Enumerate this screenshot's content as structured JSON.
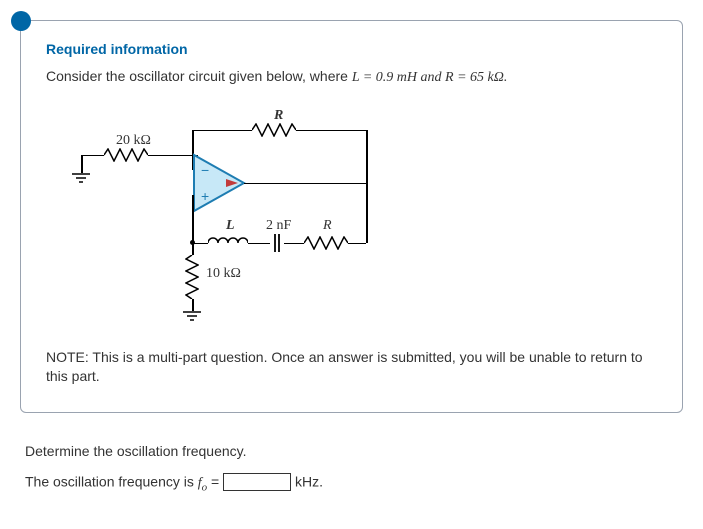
{
  "header": {
    "title": "Required information",
    "prompt_lead": "Consider the oscillator circuit given below, where ",
    "prompt_vars": "L = 0.9 mH and R = 65 kΩ."
  },
  "circuit": {
    "r_top_label": "R",
    "r_input_label": "20 kΩ",
    "L_label": "L",
    "cap_label": "2 nF",
    "R_right_label": "R",
    "r_gnd_label": "10 kΩ"
  },
  "note": "NOTE: This is a multi-part question. Once an answer is submitted, you will be unable to return to this part.",
  "question": {
    "line1": "Determine the oscillation frequency.",
    "line2_lead": "The oscillation frequency is ",
    "line2_sym": "f",
    "line2_sub": "o",
    "line2_eq": " = ",
    "unit": " kHz."
  }
}
